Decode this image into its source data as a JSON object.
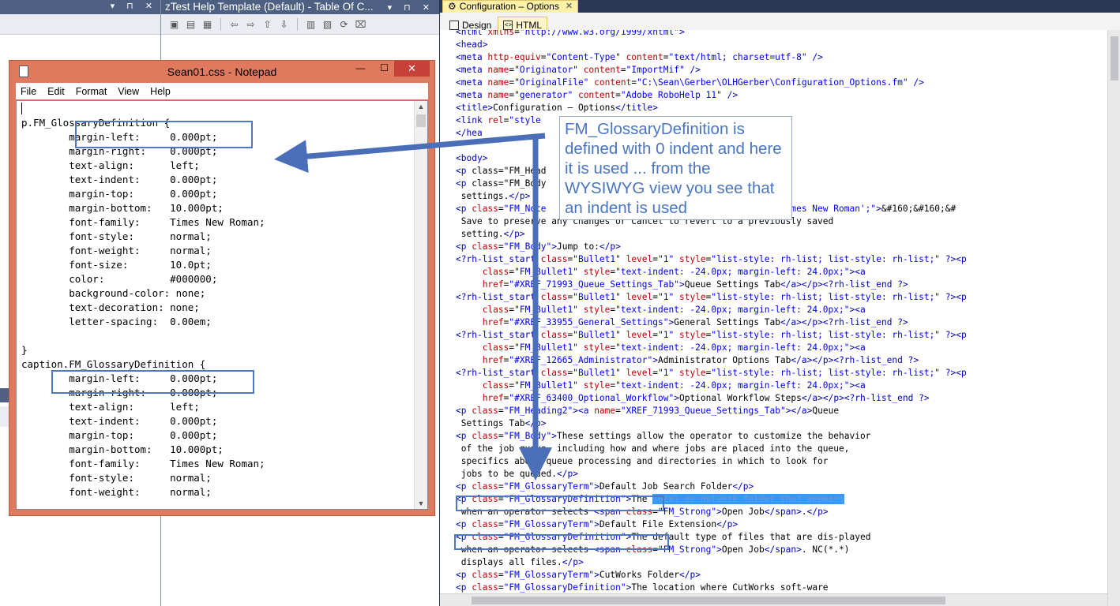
{
  "middle_pane": {
    "title": "zTest Help Template (Default) - Table Of C..."
  },
  "notepad": {
    "title": "Sean01.css - Notepad",
    "menu": [
      "File",
      "Edit",
      "Format",
      "View",
      "Help"
    ],
    "lines": [
      "p.FM_GlossaryDefinition {",
      "        margin-left:     0.000pt;",
      "        margin-right:    0.000pt;",
      "        text-align:      left;",
      "        text-indent:     0.000pt;",
      "        margin-top:      0.000pt;",
      "        margin-bottom:   10.000pt;",
      "        font-family:     Times New Roman;",
      "        font-style:      normal;",
      "        font-weight:     normal;",
      "        font-size:       10.0pt;",
      "        color:           #000000;",
      "        background-color: none;",
      "        text-decoration: none;",
      "        letter-spacing:  0.00em;",
      "",
      "}",
      "caption.FM_GlossaryDefinition {",
      "        margin-left:     0.000pt;",
      "        margin-right:    0.000pt;",
      "        text-align:      left;",
      "        text-indent:     0.000pt;",
      "        margin-top:      0.000pt;",
      "        margin-bottom:   10.000pt;",
      "        font-family:     Times New Roman;",
      "        font-style:      normal;",
      "        font-weight:     normal;"
    ]
  },
  "editor": {
    "document_tab": "Configuration – Options",
    "view_tabs": [
      "Design",
      "HTML"
    ],
    "active_view": "HTML",
    "lines": [
      "<html xmlns=\"http://www.w3.org/1999/xhtml\">",
      "<head>",
      "<meta http-equiv=\"Content-Type\" content=\"text/html; charset=utf-8\" />",
      "<meta name=\"Originator\" content=\"ImportMif\" />",
      "<meta name=\"OriginalFile\" content=\"C:\\Sean\\Gerber\\OLHGerber\\Configuration_Options.fm\" />",
      "<meta name=\"generator\" content=\"Adobe RoboHelp 11\" />",
      "<title>Configuration – Options</title>",
      "<link rel=\"style                         s\" type=\"text/css\" />",
      "</hea",
      "",
      "<body>",
      "<p class=\"FM_Head",
      "<p class=\"FM_Body                         ure various software",
      " settings.</p>",
      "<p class=\"FM_Note                         rmal; font: 6.0pt 'Times New Roman';\">&#160;&#160;&#",
      " Save to preserve any changes or Cancel to revert to a previously saved",
      " setting.</p>",
      "<p class=\"FM_Body\">Jump to:</p>",
      "<?rh-list_start class=\"Bullet1\" level=\"1\" style=\"list-style: rh-list; list-style: rh-list;\" ?><p",
      "     class=\"FM_Bullet1\" style=\"text-indent: -24.0px; margin-left: 24.0px;\"><a",
      "     href=\"#XREF_71993_Queue_Settings_Tab\">Queue Settings Tab</a></p><?rh-list_end ?>",
      "<?rh-list_start class=\"Bullet1\" level=\"1\" style=\"list-style: rh-list; list-style: rh-list;\" ?><p",
      "     class=\"FM_Bullet1\" style=\"text-indent: -24.0px; margin-left: 24.0px;\"><a",
      "     href=\"#XREF_33955_General_Settings\">General Settings Tab</a></p><?rh-list_end ?>",
      "<?rh-list_start class=\"Bullet1\" level=\"1\" style=\"list-style: rh-list; list-style: rh-list;\" ?><p",
      "     class=\"FM_Bullet1\" style=\"text-indent: -24.0px; margin-left: 24.0px;\"><a",
      "     href=\"#XREF_12665_Administrator\">Administrator Options Tab</a></p><?rh-list_end ?>",
      "<?rh-list_start class=\"Bullet1\" level=\"1\" style=\"list-style: rh-list; list-style: rh-list;\" ?><p",
      "     class=\"FM_Bullet1\" style=\"text-indent: -24.0px; margin-left: 24.0px;\"><a",
      "     href=\"#XREF_63400_Optional_Workflow\">Optional Workflow Steps</a></p><?rh-list_end ?>",
      "<p class=\"FM_Heading2\"><a name=\"XREF_71993_Queue_Settings_Tab\"></a>Queue",
      " Settings Tab</p>",
      "<p class=\"FM_Body\">These settings allow the operator to customize the behavior",
      " of the job queue, including how and where jobs are placed into the queue,",
      " specifics about queue processing and directories in which to look for",
      " jobs to be queued.</p>",
      "<p class=\"FM_GlossaryTerm\">Default Job Search Folder</p>",
      "<p class=\"FM_GlossaryDefinition\">The local or network folder that appears",
      " when an operator selects <span class=\"FM_Strong\">Open Job</span>.</p>",
      "<p class=\"FM_GlossaryTerm\">Default File Extension</p>",
      "<p class=\"FM_GlossaryDefinition\">The default type of files that are dis-played",
      " when an operator selects <span class=\"FM_Strong\">Open Job</span>. NC(*.*)",
      " displays all files.</p>",
      "<p class=\"FM_GlossaryTerm\">CutWorks Folder</p>",
      "<p class=\"FM_GlossaryDefinition\">The location where CutWorks soft-ware"
    ]
  },
  "callout": {
    "text": "FM_GlossaryDefinition is defined with 0 indent and here it is used ... from the WYSIWYG view you see that an indent is used"
  },
  "colors": {
    "annotation_blue": "#4f78c4",
    "vs_frame": "#293955",
    "notepad_frame": "#e07a5f"
  }
}
